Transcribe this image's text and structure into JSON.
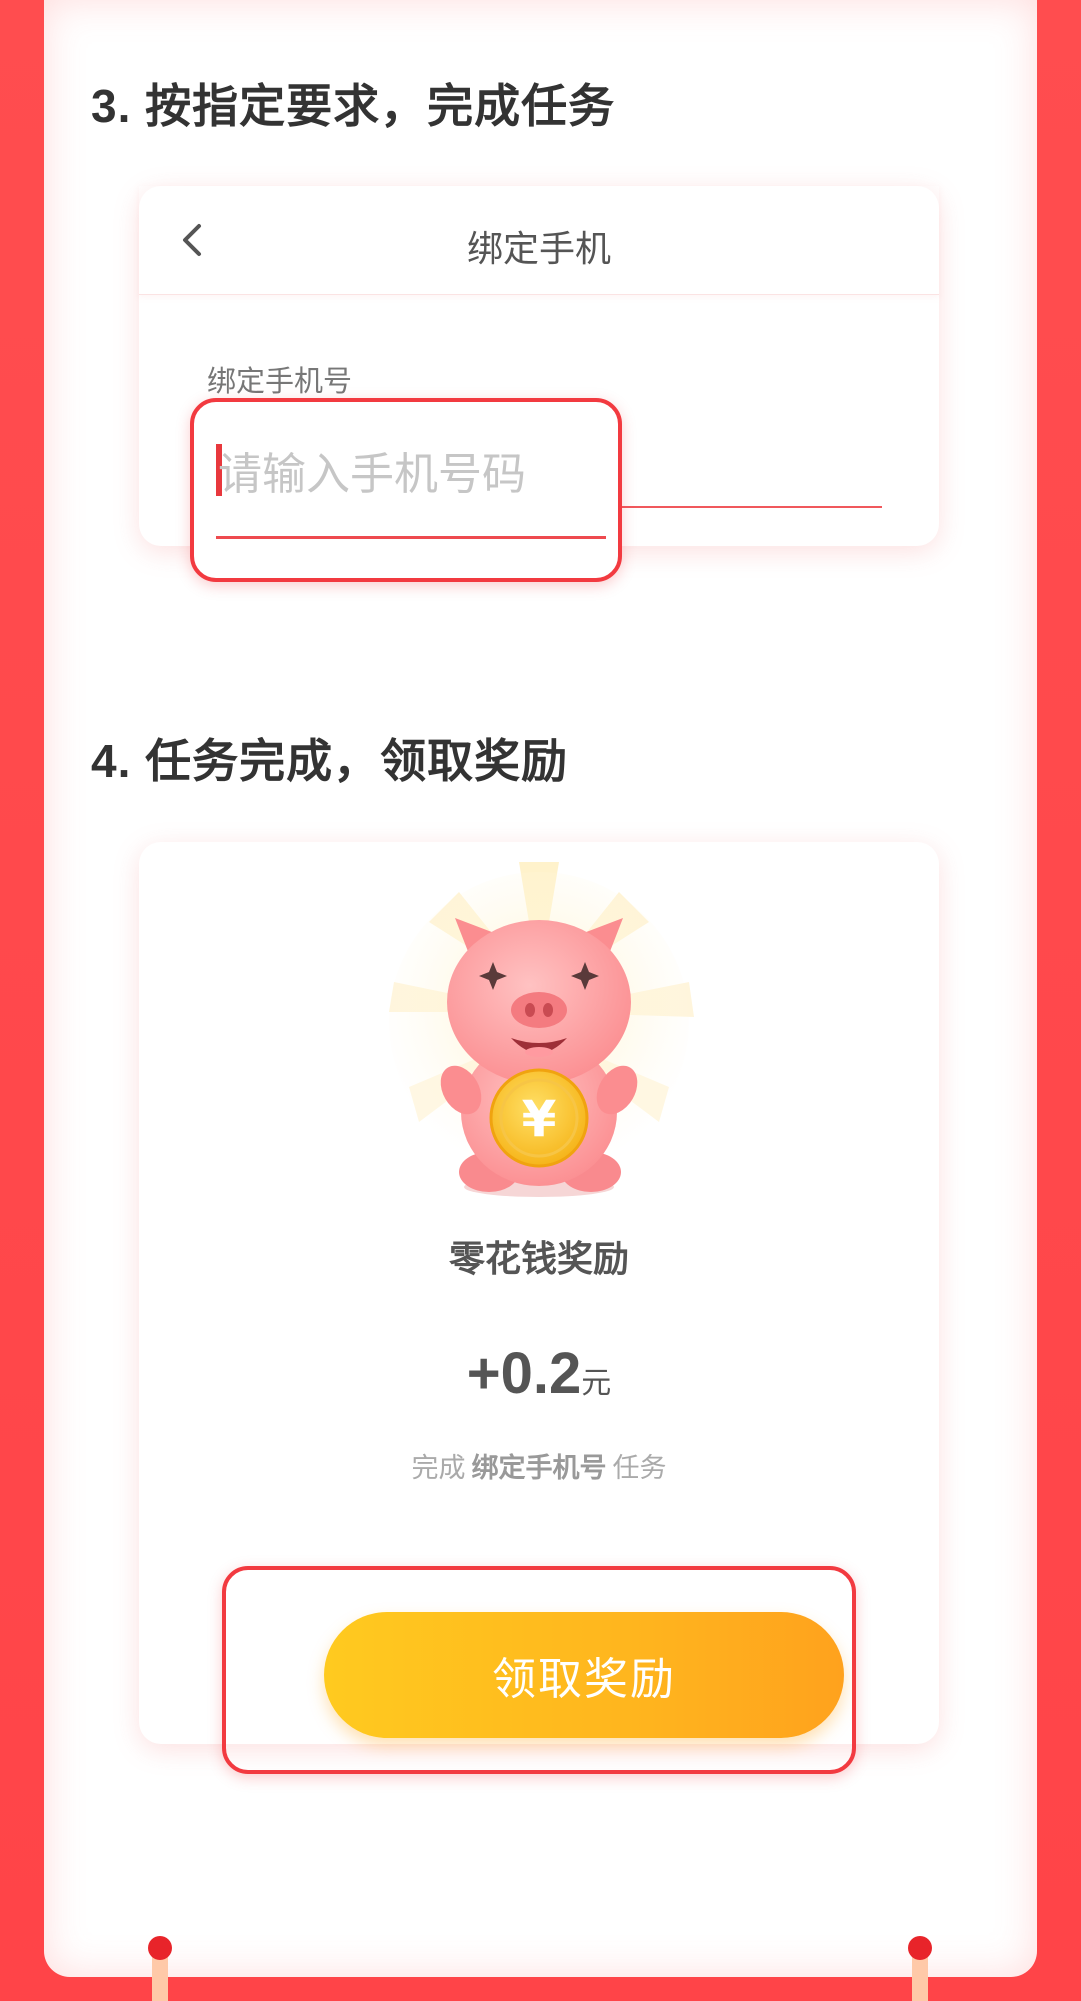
{
  "steps": {
    "step3_title": "3. 按指定要求，完成任务",
    "step4_title": "4. 任务完成，领取奖励"
  },
  "bind_card": {
    "title": "绑定手机",
    "field_label": "绑定手机号",
    "placeholder": "请输入手机号码"
  },
  "reward_card": {
    "title": "零花钱奖励",
    "amount": "+0.2",
    "unit": "元",
    "desc_prefix": "完成",
    "desc_task": "绑定手机号",
    "desc_suffix": "任务",
    "claim_label": "领取奖励"
  },
  "icons": {
    "back": "chevron-left-icon",
    "mascot": "pig-coin-icon"
  },
  "colors": {
    "brand_red": "#ff4d4f",
    "highlight": "#f23a40",
    "button_start": "#ffca1f",
    "button_end": "#ffa21d"
  }
}
